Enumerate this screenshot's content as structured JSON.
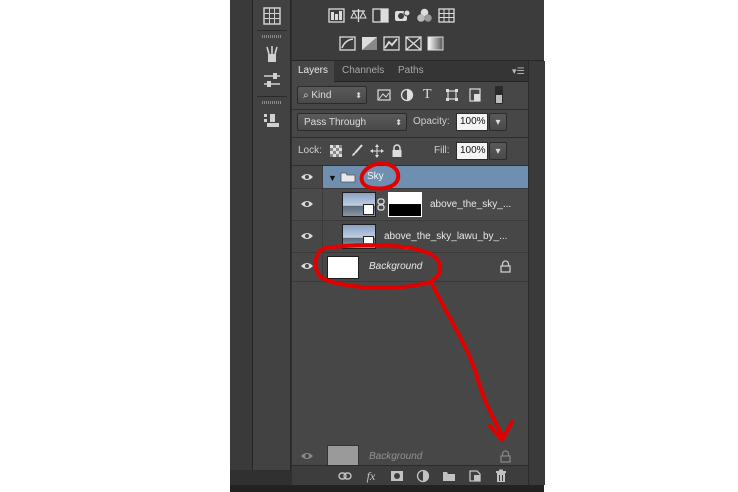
{
  "tabs": [
    {
      "label": "Layers",
      "active": true
    },
    {
      "label": "Channels",
      "active": false
    },
    {
      "label": "Paths",
      "active": false
    }
  ],
  "filter": {
    "kind_label": "Kind"
  },
  "blend": {
    "mode": "Pass Through",
    "opacity_label": "Opacity:",
    "opacity_value": "100%"
  },
  "lock": {
    "label": "Lock:",
    "fill_label": "Fill:",
    "fill_value": "100%"
  },
  "layers": [
    {
      "name": "Sky",
      "type": "group",
      "expanded": true
    },
    {
      "name": "above_the_sky_...",
      "type": "adjusted-with-mask"
    },
    {
      "name": "above_the_sky_lawu_by_...",
      "type": "smart-object"
    },
    {
      "name": "Background",
      "type": "background",
      "locked": true
    }
  ],
  "drag_ghost": {
    "name": "Background"
  },
  "annotation": {
    "color": "#e00000"
  },
  "colors": {
    "panel_bg": "#474747",
    "selected_row": "#6f8fb1",
    "frame_bg": "#303030"
  }
}
